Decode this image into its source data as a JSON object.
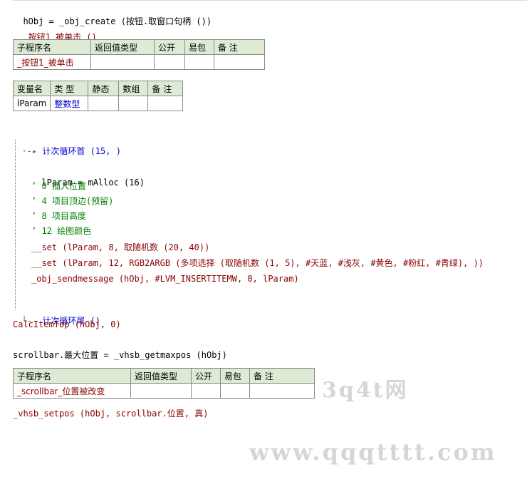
{
  "lines": {
    "l1": "hObj = _obj_create (按钮.取窗口句柄 ())",
    "l2": "_按钮1_被单击 ()",
    "loop_start": "计次循环首 (15, )",
    "a1": "lParam = mAlloc (16)",
    "c1": "’ 0 插入位置",
    "c2": "’ 4 项目顶边(预留)",
    "c3": "’ 8 项目高度",
    "c4": "’ 12 绘图颜色",
    "s1": "__set (lParam, 8, 取随机数 (20, 40))",
    "s2": "__set (lParam, 12, RGB2ARGB (多项选择 (取随机数 (1, 5), #天蓝, #浅灰, #黄色, #粉红, #青绿), ))",
    "s3": "_obj_sendmessage (hObj, #LVM_INSERTITEMW, 0, lParam)",
    "loop_end": "计次循环尾 ()",
    "calc": "CalcItemTop (hObj, 0)",
    "scroll": "scrollbar.最大位置 = _vhsb_getmaxpos (hObj)",
    "setpos": "_vhsb_setpos (hObj, scrollbar.位置, 真)"
  },
  "sub1_table": {
    "headers": [
      "子程序名",
      "返回值类型",
      "公开",
      "易包",
      "备 注"
    ],
    "row": [
      "_按钮1_被单击",
      "",
      "",
      "",
      ""
    ]
  },
  "var_table": {
    "headers": [
      "变量名",
      "类 型",
      "静态",
      "数组",
      "备 注"
    ],
    "row": [
      "lParam",
      "整数型",
      "",
      "",
      ""
    ]
  },
  "sub2_table": {
    "headers": [
      "子程序名",
      "返回值类型",
      "公开",
      "易包",
      "备 注"
    ],
    "row": [
      "_scrollbar_位置被改变",
      "",
      "",
      "",
      ""
    ]
  },
  "watermarks": {
    "w1": "3q4t网",
    "w2": "www.qqqtttt.com"
  }
}
